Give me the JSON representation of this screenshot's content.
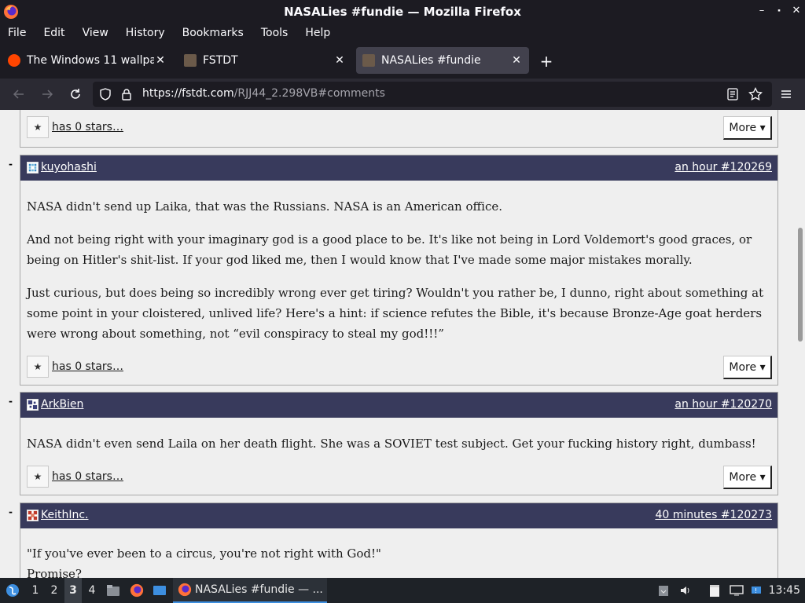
{
  "window": {
    "title": "NASALies #fundie — Mozilla Firefox",
    "controls": [
      "–",
      "⬝",
      "✕"
    ]
  },
  "menubar": {
    "items": [
      "File",
      "Edit",
      "View",
      "History",
      "Bookmarks",
      "Tools",
      "Help"
    ]
  },
  "tabs": [
    {
      "label": "The Windows 11 wallpap",
      "icon": "reddit-icon",
      "icon_color": "#ff4500"
    },
    {
      "label": "FSTDT",
      "icon": "fstdt-icon",
      "icon_color": "#6b5a4a"
    },
    {
      "label": "NASALies #fundie",
      "icon": "fstdt-icon",
      "icon_color": "#6b5a4a",
      "active": true
    }
  ],
  "newtab_label": "+",
  "urlbar": {
    "url_host": "https://fstdt.com",
    "url_path": "/RJJ44_2.298VB#comments"
  },
  "comments": [
    {
      "partial": true,
      "stars_text": "has 0 stars…",
      "more_label": "More ▾"
    },
    {
      "user": "kuyohashi",
      "meta": "an hour #120269",
      "paragraphs": [
        "NASA didn't send up Laika, that was the Russians. NASA is an American office.",
        "And not being right with your imaginary god is a good place to be. It's like not being in Lord Voldemort's good graces, or being on Hitler's shit-list. If your god liked me, then I would know that I've made some major mistakes morally.",
        "Just curious, but does being so incredibly wrong ever get tiring? Wouldn't you rather be, I dunno, right about something at some point in your cloistered, unlived life? Here's a hint: if science refutes the Bible, it's because Bronze-Age goat herders were wrong about something, not “evil conspiracy to steal my god!!!”"
      ],
      "stars_text": "has 0 stars…",
      "more_label": "More ▾"
    },
    {
      "user": "ArkBien",
      "meta": "an hour #120270",
      "paragraphs": [
        "NASA didn't even send Laila on her death flight. She was a SOVIET test subject. Get your fucking history right, dumbass!"
      ],
      "stars_text": "has 0 stars…",
      "more_label": "More ▾"
    },
    {
      "user": "KeithInc.",
      "meta": "40 minutes #120273",
      "paragraphs": [
        "\"If you've ever been to a circus, you're not right with God!\"",
        "Promise?"
      ]
    }
  ],
  "collapse_label": "-",
  "star_glyph": "★",
  "taskbar": {
    "workspaces": [
      "1",
      "2",
      "3",
      "4"
    ],
    "active_workspace": "3",
    "task_label": "NASALies #fundie — ...",
    "clock": "13:45"
  }
}
